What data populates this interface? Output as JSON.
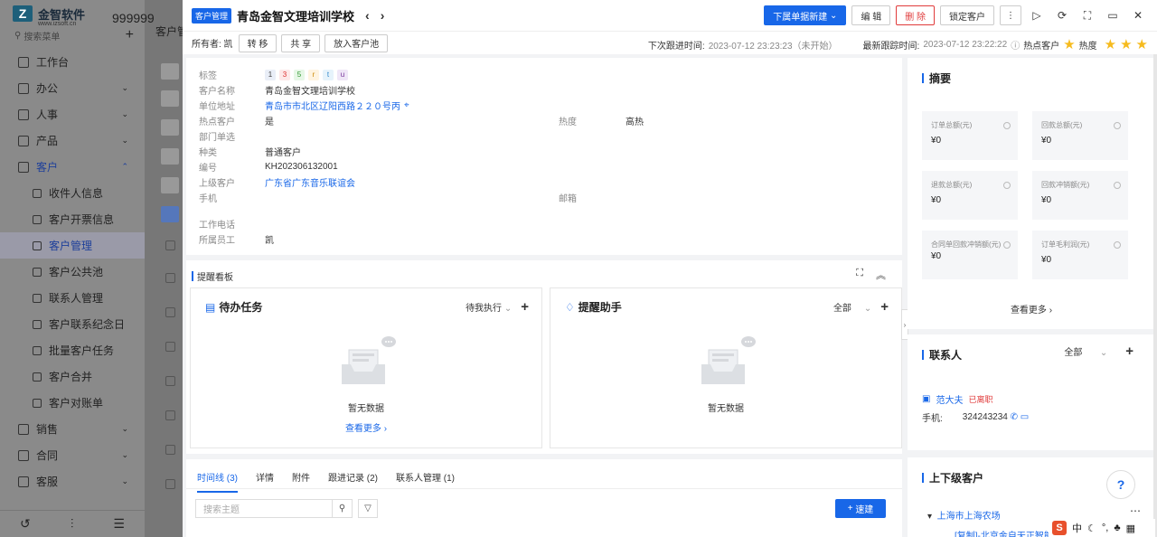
{
  "app": {
    "logo_mark": "Z",
    "logo_name": "金智软件",
    "logo_url": "www.izsoft.cn",
    "tenant": "999999",
    "search_placeholder": "搜索菜单"
  },
  "sidebar": {
    "items": [
      {
        "label": "工作台",
        "type": "top"
      },
      {
        "label": "办公",
        "type": "group"
      },
      {
        "label": "人事",
        "type": "group"
      },
      {
        "label": "产品",
        "type": "group"
      },
      {
        "label": "客户",
        "type": "group-open"
      },
      {
        "label": "收件人信息",
        "type": "sub"
      },
      {
        "label": "客户开票信息",
        "type": "sub"
      },
      {
        "label": "客户管理",
        "type": "sub-active"
      },
      {
        "label": "客户公共池",
        "type": "sub"
      },
      {
        "label": "联系人管理",
        "type": "sub"
      },
      {
        "label": "客户联系纪念日",
        "type": "sub"
      },
      {
        "label": "批量客户任务",
        "type": "sub"
      },
      {
        "label": "客户合并",
        "type": "sub"
      },
      {
        "label": "客户对账单",
        "type": "sub"
      },
      {
        "label": "销售",
        "type": "group"
      },
      {
        "label": "合同",
        "type": "group"
      },
      {
        "label": "客服",
        "type": "group"
      }
    ]
  },
  "backdrop": {
    "page_title": "客户管"
  },
  "drawer": {
    "module_tag": "客户管理",
    "title": "青岛金智文理培训学校",
    "actions": {
      "new_doc": "下属单据新建",
      "edit": "编 辑",
      "delete": "删 除",
      "lock": "锁定客户"
    },
    "owner_label": "所有者: 凯",
    "sub_actions": {
      "transfer": "转 移",
      "share": "共 享",
      "pool": "放入客户池"
    },
    "next_follow_label": "下次跟进时间:",
    "next_follow_value": "2023-07-12 23:23:23（未开始）",
    "last_follow_label": "最新跟踪时间:",
    "last_follow_value": "2023-07-12 23:22:22",
    "hot_label": "热点客户",
    "heat_label": "热度",
    "heat_stars": 3
  },
  "detail": {
    "tags_label": "标签",
    "tags": [
      {
        "t": "1",
        "bg": "#e9eef7",
        "fg": "#444"
      },
      {
        "t": "3",
        "bg": "#fde8e8",
        "fg": "#d33"
      },
      {
        "t": "5",
        "bg": "#e6f7e6",
        "fg": "#393"
      },
      {
        "t": "r",
        "bg": "#fff4e0",
        "fg": "#c80"
      },
      {
        "t": "t",
        "bg": "#e6f3fb",
        "fg": "#38c"
      },
      {
        "t": "u",
        "bg": "#efe6f7",
        "fg": "#739"
      }
    ],
    "fields": {
      "name_label": "客户名称",
      "name": "青岛金智文理培训学校",
      "address_label": "单位地址",
      "address": "青岛市市北区辽阳西路２２０号丙",
      "hot_label": "热点客户",
      "hot": "是",
      "heat_label": "热度",
      "heat": "高热",
      "dept_label": "部门单选",
      "dept": "",
      "type_label": "种类",
      "type": "普通客户",
      "code_label": "编号",
      "code": "KH202306132001",
      "parent_label": "上级客户",
      "parent": "广东省广东音乐联谊会",
      "mobile_label": "手机",
      "mobile": "",
      "email_label": "邮箱",
      "email": "",
      "work_phone_label": "工作电话",
      "work_phone": "",
      "staff_label": "所属员工",
      "staff": "凯"
    }
  },
  "board": {
    "title": "提醒看板",
    "todo": {
      "title": "待办任务",
      "filter": "待我执行",
      "empty": "暂无数据",
      "more": "查看更多"
    },
    "remind": {
      "title": "提醒助手",
      "filter": "全部",
      "empty": "暂无数据"
    }
  },
  "tabs": {
    "items": [
      "时间线 (3)",
      "详情",
      "附件",
      "跟进记录 (2)",
      "联系人管理 (1)"
    ],
    "search_placeholder": "搜索主题",
    "quick_new": "速建"
  },
  "summary": {
    "title": "摘要",
    "metrics": [
      {
        "label": "订单总额(元)",
        "value": "¥0"
      },
      {
        "label": "回款总额(元)",
        "value": "¥0"
      },
      {
        "label": "退款总额(元)",
        "value": "¥0"
      },
      {
        "label": "回款冲销额(元)",
        "value": "¥0"
      },
      {
        "label": "合同单回款冲销额(元)",
        "value": "¥0"
      },
      {
        "label": "订单毛利润(元)",
        "value": "¥0"
      }
    ],
    "more": "查看更多"
  },
  "contacts": {
    "title": "联系人",
    "filter": "全部",
    "name": "范大夫",
    "status": "已离职",
    "phone_label": "手机:",
    "phone": "324243234"
  },
  "parents": {
    "title": "上下级客户",
    "item1": "上海市上海农场",
    "item2": "[复制]-北京金自天正智能控"
  },
  "ime": {
    "logo": "S",
    "lang": "中"
  },
  "colors": {
    "accent": "#1867e8",
    "danger": "#e03b3b",
    "star": "#f6bb1e"
  }
}
